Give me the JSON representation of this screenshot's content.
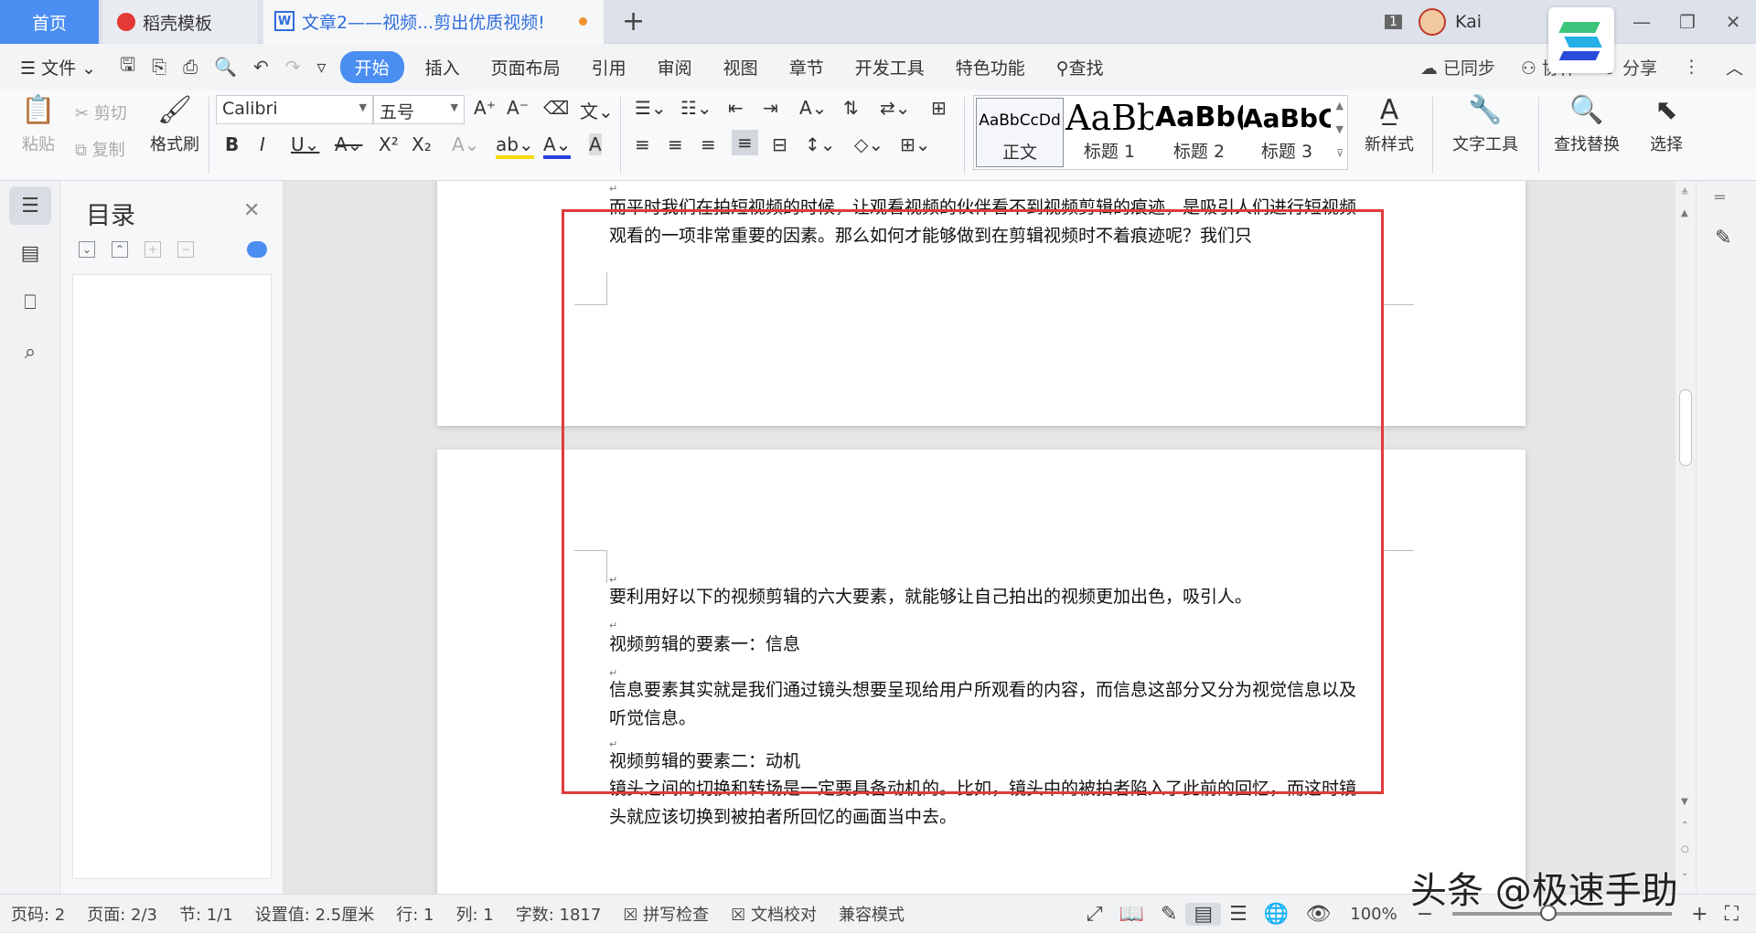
{
  "titlebar": {
    "tabs": [
      {
        "label": "首页"
      },
      {
        "label": "稻壳模板"
      },
      {
        "label": "文章2——视频...剪出优质视频!"
      }
    ],
    "new_tab": "+",
    "window_count": "1",
    "user": "Kai",
    "controls": {
      "minimize": "—",
      "restore": "❐",
      "close": "✕"
    }
  },
  "menu": {
    "file": "文件",
    "tabs": [
      "开始",
      "插入",
      "页面布局",
      "引用",
      "审阅",
      "视图",
      "章节",
      "开发工具",
      "特色功能"
    ],
    "search": "查找",
    "synced": "已同步",
    "collab": "协作",
    "share": "分享"
  },
  "ribbon": {
    "paste": "粘贴",
    "cut": "剪切",
    "copy": "复制",
    "format_painter": "格式刷",
    "font_name": "Calibri",
    "font_size": "五号",
    "styles": [
      {
        "preview": "AaBbCcDd",
        "name": "正文"
      },
      {
        "preview": "AaBb",
        "name": "标题 1"
      },
      {
        "preview": "AaBb(",
        "name": "标题 2"
      },
      {
        "preview": "AaBbC(",
        "name": "标题 3"
      }
    ],
    "new_style": "新样式",
    "text_tools": "文字工具",
    "find_replace": "查找替换",
    "select": "选择"
  },
  "toc": {
    "title": "目录"
  },
  "document": {
    "page1_paragraph": "而平时我们在拍短视频的时候，让观看视频的伙伴看不到视频剪辑的痕迹，是吸引人们进行短视频观看的一项非常重要的因素。那么如何才能够做到在剪辑视频时不着痕迹呢？我们只",
    "paragraphs": [
      "要利用好以下的视频剪辑的六大要素，就能够让自己拍出的视频更加出色，吸引人。",
      "视频剪辑的要素一：信息",
      "信息要素其实就是我们通过镜头想要呈现给用户所观看的内容，而信息这部分又分为视觉信息以及听觉信息。",
      "视频剪辑的要素二：动机",
      "镜头之间的切换和转场是一定要具备动机的。比如，镜头中的被拍者陷入了此前的回忆，而这时镜头就应该切换到被拍者所回忆的画面当中去。"
    ],
    "para_mark": "↵"
  },
  "status": {
    "page_code": "页码: 2",
    "page": "页面: 2/3",
    "section": "节: 1/1",
    "setting": "设置值: 2.5厘米",
    "row": "行: 1",
    "col": "列: 1",
    "word_count": "字数: 1817",
    "spell_check": "拼写检查",
    "doc_proof": "文档校对",
    "compat": "兼容模式",
    "zoom": "100%"
  },
  "watermark": "头条 @极速手助",
  "colors": {
    "accent": "#4b8ef2",
    "highlight_box": "#e03b3b"
  }
}
